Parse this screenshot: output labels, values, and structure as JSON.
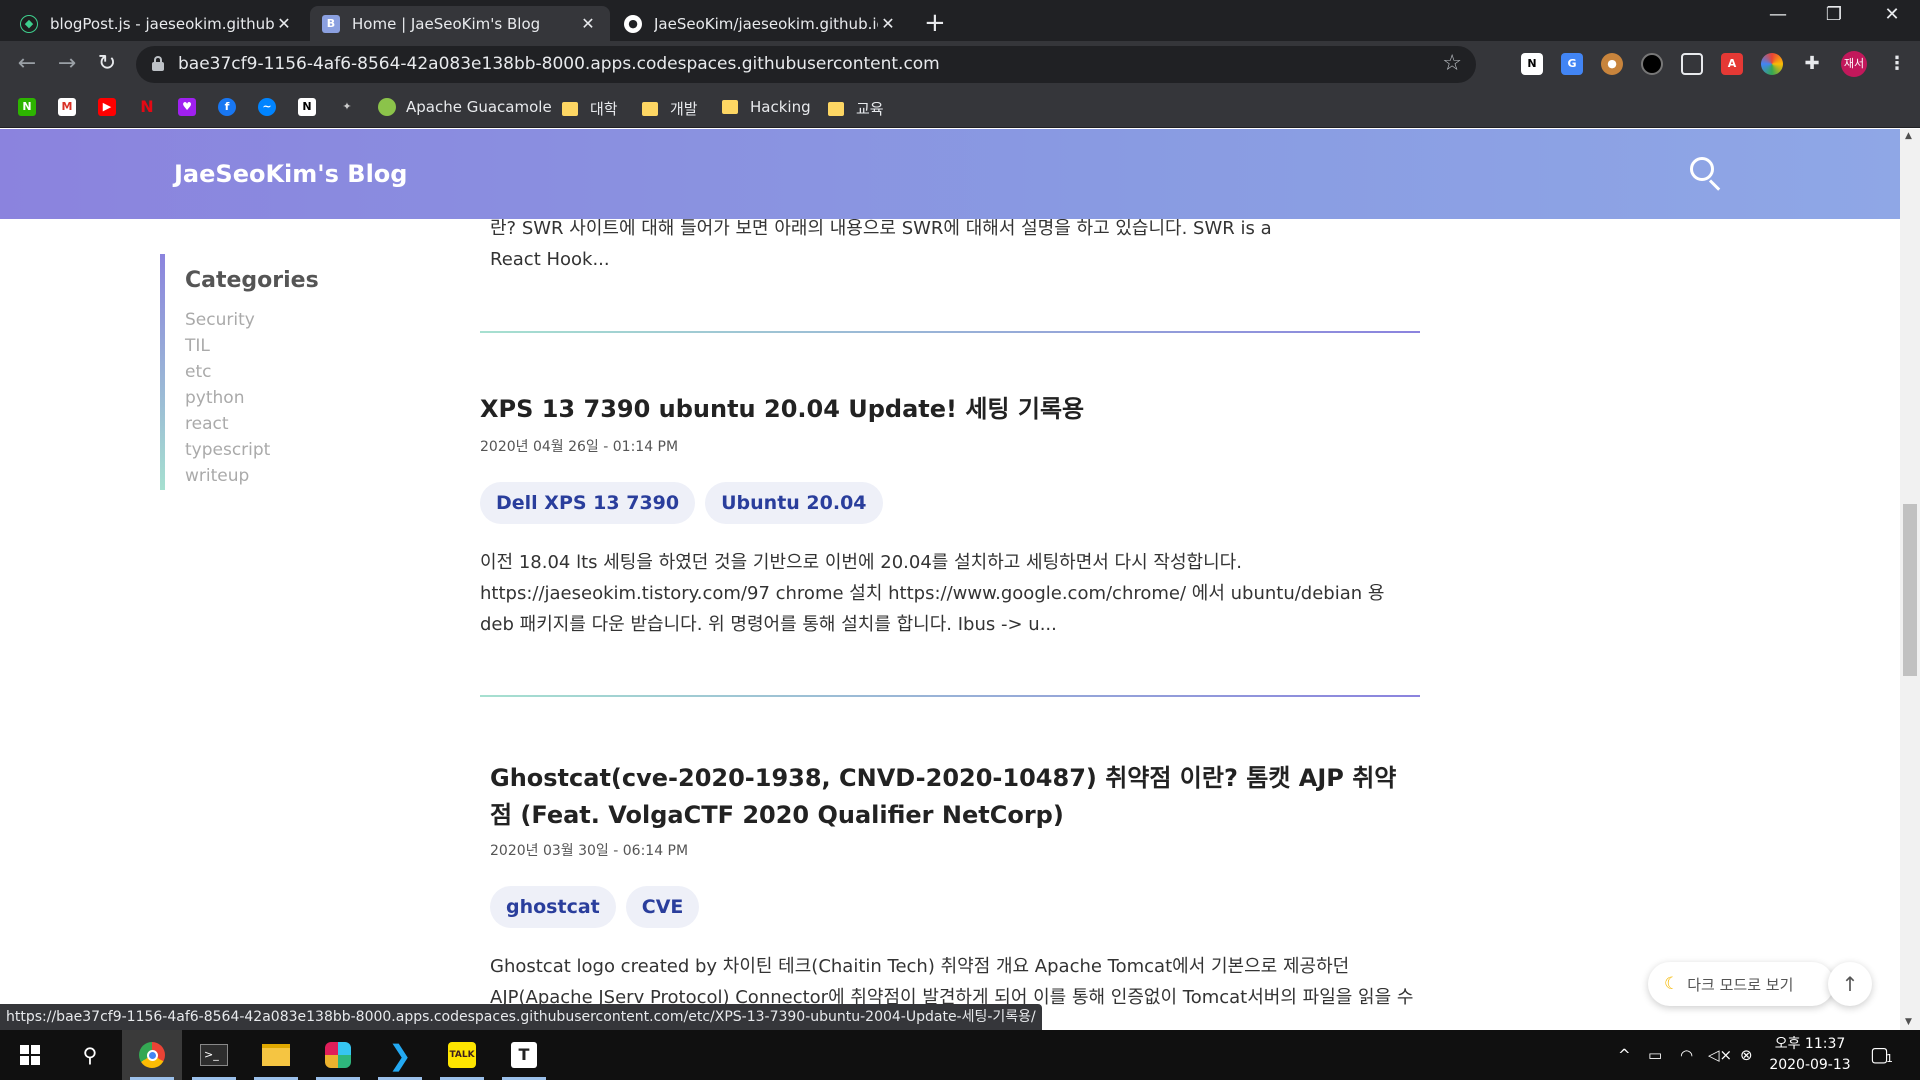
{
  "browser": {
    "tabs": [
      {
        "label": "blogPost.js - jaeseokim.github.io",
        "active": false
      },
      {
        "label": "Home | JaeSeoKim's Blog",
        "active": true
      },
      {
        "label": "JaeSeoKim/jaeseokim.github.io",
        "active": false
      }
    ],
    "url": "bae37cf9-1156-4af6-8564-42a083e138bb-8000.apps.codespaces.githubusercontent.com",
    "bookmarks": [
      "Apache Guacamole",
      "대학",
      "개발",
      "Hacking",
      "교육"
    ],
    "profile_label": "재서",
    "status_url": "https://bae37cf9-1156-4af6-8564-42a083e138bb-8000.apps.codespaces.githubusercontent.com/etc/XPS-13-7390-ubuntu-2004-Update-세팅-기록용/"
  },
  "site": {
    "title": "JaeSeoKim's Blog",
    "categories_title": "Categories",
    "categories": [
      "Security",
      "TIL",
      "etc",
      "python",
      "react",
      "typescript",
      "writeup"
    ]
  },
  "prev_excerpt": {
    "line1": "란? SWR 사이트에 대해 들어가 보면 아래의 내용으로 SWR에 대해서 설명을 하고 있습니다. SWR is a",
    "line2": "React Hook..."
  },
  "posts": [
    {
      "title": "XPS 13 7390 ubuntu 20.04 Update! 세팅 기록용",
      "date": "2020년 04월 26일 - 01:14 PM",
      "tags": [
        "Dell XPS 13 7390",
        "Ubuntu 20.04"
      ],
      "excerpt": "이전 18.04 lts 세팅을 하였던 것을 기반으로 이번에 20.04를 설치하고 세팅하면서 다시 작성합니다. https://jaeseokim.tistory.com/97 chrome 설치 https://www.google.com/chrome/ 에서 ubuntu/debian 용 deb 패키지를 다운 받습니다. 위 명령어를 통해 설치를 합니다. Ibus -> u..."
    },
    {
      "title": "Ghostcat(cve-2020-1938, CNVD-2020-10487) 취약점 이란? 톰캣 AJP 취약점 (Feat. VolgaCTF 2020 Qualifier NetCorp)",
      "date": "2020년 03월 30일 - 06:14 PM",
      "tags": [
        "ghostcat",
        "CVE"
      ],
      "excerpt": "Ghostcat logo created by 차이틴 테크(Chaitin Tech) 취약점 개요 Apache Tomcat에서 기본으로 제공하던 AJP(Apache JServ Protocol) Connector에 취약점이 발견하게 되어 이를 통해 인증없이 Tomcat서버의 파일을 읽을 수 있습니다. 또한 파일 업로드가 가능한"
    }
  ],
  "floating": {
    "dark_mode": "다크 모드로 보기",
    "top_button": "↑"
  },
  "taskbar": {
    "time_line1": "오후 11:37",
    "time_line2": "2020-09-13",
    "notification_count": "1"
  }
}
